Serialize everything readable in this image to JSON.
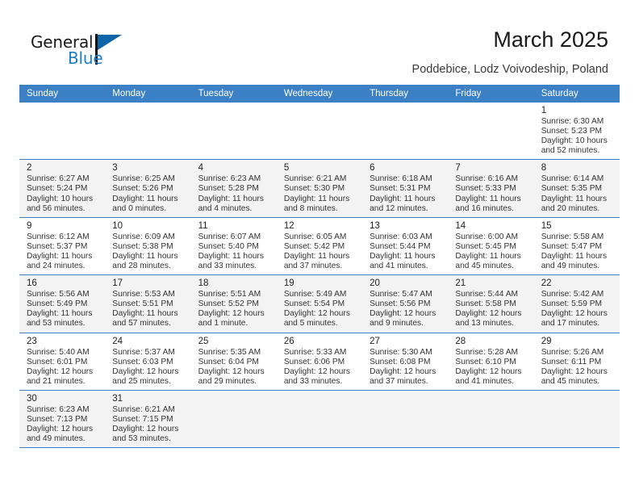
{
  "brand": {
    "name_dark": "General",
    "name_light": "Blue",
    "flag_color": "#0d66ab",
    "blue_color": "#1c7ec4"
  },
  "header": {
    "title": "March 2025",
    "subtitle": "Poddebice, Lodz Voivodeship, Poland"
  },
  "theme": {
    "header_row_bg": "#3b7fc4",
    "header_row_text": "#ffffff",
    "alt_row_bg": "#f3f3f3",
    "row_border": "#3b7fc4"
  },
  "weekdays": [
    "Sunday",
    "Monday",
    "Tuesday",
    "Wednesday",
    "Thursday",
    "Friday",
    "Saturday"
  ],
  "labels": {
    "sunrise_prefix": "Sunrise:",
    "sunset_prefix": "Sunset:",
    "daylight_prefix": "Daylight:"
  },
  "weeks": [
    [
      {
        "day": "",
        "empty": true
      },
      {
        "day": "",
        "empty": true
      },
      {
        "day": "",
        "empty": true
      },
      {
        "day": "",
        "empty": true
      },
      {
        "day": "",
        "empty": true
      },
      {
        "day": "",
        "empty": true
      },
      {
        "day": "1",
        "sunrise": "Sunrise: 6:30 AM",
        "sunset": "Sunset: 5:23 PM",
        "daylight1": "Daylight: 10 hours",
        "daylight2": "and 52 minutes."
      }
    ],
    [
      {
        "day": "2",
        "sunrise": "Sunrise: 6:27 AM",
        "sunset": "Sunset: 5:24 PM",
        "daylight1": "Daylight: 10 hours",
        "daylight2": "and 56 minutes."
      },
      {
        "day": "3",
        "sunrise": "Sunrise: 6:25 AM",
        "sunset": "Sunset: 5:26 PM",
        "daylight1": "Daylight: 11 hours",
        "daylight2": "and 0 minutes."
      },
      {
        "day": "4",
        "sunrise": "Sunrise: 6:23 AM",
        "sunset": "Sunset: 5:28 PM",
        "daylight1": "Daylight: 11 hours",
        "daylight2": "and 4 minutes."
      },
      {
        "day": "5",
        "sunrise": "Sunrise: 6:21 AM",
        "sunset": "Sunset: 5:30 PM",
        "daylight1": "Daylight: 11 hours",
        "daylight2": "and 8 minutes."
      },
      {
        "day": "6",
        "sunrise": "Sunrise: 6:18 AM",
        "sunset": "Sunset: 5:31 PM",
        "daylight1": "Daylight: 11 hours",
        "daylight2": "and 12 minutes."
      },
      {
        "day": "7",
        "sunrise": "Sunrise: 6:16 AM",
        "sunset": "Sunset: 5:33 PM",
        "daylight1": "Daylight: 11 hours",
        "daylight2": "and 16 minutes."
      },
      {
        "day": "8",
        "sunrise": "Sunrise: 6:14 AM",
        "sunset": "Sunset: 5:35 PM",
        "daylight1": "Daylight: 11 hours",
        "daylight2": "and 20 minutes."
      }
    ],
    [
      {
        "day": "9",
        "sunrise": "Sunrise: 6:12 AM",
        "sunset": "Sunset: 5:37 PM",
        "daylight1": "Daylight: 11 hours",
        "daylight2": "and 24 minutes."
      },
      {
        "day": "10",
        "sunrise": "Sunrise: 6:09 AM",
        "sunset": "Sunset: 5:38 PM",
        "daylight1": "Daylight: 11 hours",
        "daylight2": "and 28 minutes."
      },
      {
        "day": "11",
        "sunrise": "Sunrise: 6:07 AM",
        "sunset": "Sunset: 5:40 PM",
        "daylight1": "Daylight: 11 hours",
        "daylight2": "and 33 minutes."
      },
      {
        "day": "12",
        "sunrise": "Sunrise: 6:05 AM",
        "sunset": "Sunset: 5:42 PM",
        "daylight1": "Daylight: 11 hours",
        "daylight2": "and 37 minutes."
      },
      {
        "day": "13",
        "sunrise": "Sunrise: 6:03 AM",
        "sunset": "Sunset: 5:44 PM",
        "daylight1": "Daylight: 11 hours",
        "daylight2": "and 41 minutes."
      },
      {
        "day": "14",
        "sunrise": "Sunrise: 6:00 AM",
        "sunset": "Sunset: 5:45 PM",
        "daylight1": "Daylight: 11 hours",
        "daylight2": "and 45 minutes."
      },
      {
        "day": "15",
        "sunrise": "Sunrise: 5:58 AM",
        "sunset": "Sunset: 5:47 PM",
        "daylight1": "Daylight: 11 hours",
        "daylight2": "and 49 minutes."
      }
    ],
    [
      {
        "day": "16",
        "sunrise": "Sunrise: 5:56 AM",
        "sunset": "Sunset: 5:49 PM",
        "daylight1": "Daylight: 11 hours",
        "daylight2": "and 53 minutes."
      },
      {
        "day": "17",
        "sunrise": "Sunrise: 5:53 AM",
        "sunset": "Sunset: 5:51 PM",
        "daylight1": "Daylight: 11 hours",
        "daylight2": "and 57 minutes."
      },
      {
        "day": "18",
        "sunrise": "Sunrise: 5:51 AM",
        "sunset": "Sunset: 5:52 PM",
        "daylight1": "Daylight: 12 hours",
        "daylight2": "and 1 minute."
      },
      {
        "day": "19",
        "sunrise": "Sunrise: 5:49 AM",
        "sunset": "Sunset: 5:54 PM",
        "daylight1": "Daylight: 12 hours",
        "daylight2": "and 5 minutes."
      },
      {
        "day": "20",
        "sunrise": "Sunrise: 5:47 AM",
        "sunset": "Sunset: 5:56 PM",
        "daylight1": "Daylight: 12 hours",
        "daylight2": "and 9 minutes."
      },
      {
        "day": "21",
        "sunrise": "Sunrise: 5:44 AM",
        "sunset": "Sunset: 5:58 PM",
        "daylight1": "Daylight: 12 hours",
        "daylight2": "and 13 minutes."
      },
      {
        "day": "22",
        "sunrise": "Sunrise: 5:42 AM",
        "sunset": "Sunset: 5:59 PM",
        "daylight1": "Daylight: 12 hours",
        "daylight2": "and 17 minutes."
      }
    ],
    [
      {
        "day": "23",
        "sunrise": "Sunrise: 5:40 AM",
        "sunset": "Sunset: 6:01 PM",
        "daylight1": "Daylight: 12 hours",
        "daylight2": "and 21 minutes."
      },
      {
        "day": "24",
        "sunrise": "Sunrise: 5:37 AM",
        "sunset": "Sunset: 6:03 PM",
        "daylight1": "Daylight: 12 hours",
        "daylight2": "and 25 minutes."
      },
      {
        "day": "25",
        "sunrise": "Sunrise: 5:35 AM",
        "sunset": "Sunset: 6:04 PM",
        "daylight1": "Daylight: 12 hours",
        "daylight2": "and 29 minutes."
      },
      {
        "day": "26",
        "sunrise": "Sunrise: 5:33 AM",
        "sunset": "Sunset: 6:06 PM",
        "daylight1": "Daylight: 12 hours",
        "daylight2": "and 33 minutes."
      },
      {
        "day": "27",
        "sunrise": "Sunrise: 5:30 AM",
        "sunset": "Sunset: 6:08 PM",
        "daylight1": "Daylight: 12 hours",
        "daylight2": "and 37 minutes."
      },
      {
        "day": "28",
        "sunrise": "Sunrise: 5:28 AM",
        "sunset": "Sunset: 6:10 PM",
        "daylight1": "Daylight: 12 hours",
        "daylight2": "and 41 minutes."
      },
      {
        "day": "29",
        "sunrise": "Sunrise: 5:26 AM",
        "sunset": "Sunset: 6:11 PM",
        "daylight1": "Daylight: 12 hours",
        "daylight2": "and 45 minutes."
      }
    ],
    [
      {
        "day": "30",
        "sunrise": "Sunrise: 6:23 AM",
        "sunset": "Sunset: 7:13 PM",
        "daylight1": "Daylight: 12 hours",
        "daylight2": "and 49 minutes."
      },
      {
        "day": "31",
        "sunrise": "Sunrise: 6:21 AM",
        "sunset": "Sunset: 7:15 PM",
        "daylight1": "Daylight: 12 hours",
        "daylight2": "and 53 minutes."
      },
      {
        "day": "",
        "empty": true
      },
      {
        "day": "",
        "empty": true
      },
      {
        "day": "",
        "empty": true
      },
      {
        "day": "",
        "empty": true
      },
      {
        "day": "",
        "empty": true
      }
    ]
  ]
}
